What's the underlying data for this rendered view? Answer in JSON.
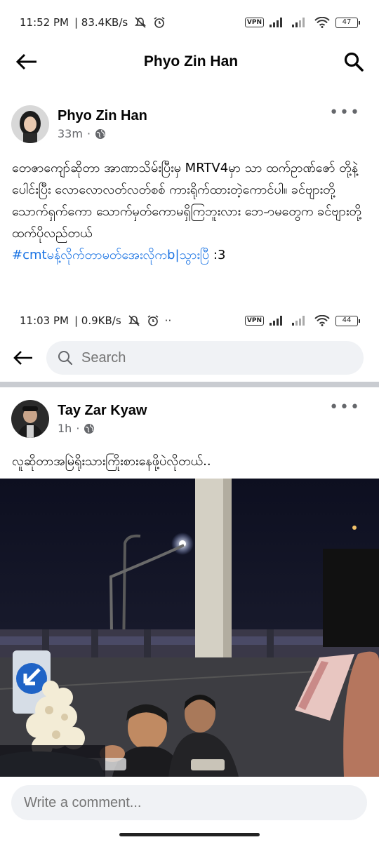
{
  "status_bar": {
    "time": "11:52 PM",
    "speed": "| 83.4KB/s",
    "vpn": "VPN",
    "battery": "47"
  },
  "appbar": {
    "title": "Phyo Zin Han"
  },
  "post1": {
    "author": "Phyo Zin Han",
    "time": "33m",
    "dot": "·",
    "more": "•••",
    "text": "တေဇာကျော်ဆိုတာ အာဏာသိမ်းပြီးမှ MRTV4မှာ သာ ထက်ဥာဏ်ဇော် တို့နဲ့ပေါင်းပြီး  လောလောလတ်လတ်စစ် ကားရိုက်ထားတဲ့ကောင်ပါ။ ခင်ဗျားတို့သောက်ရှက်ကော သောက်မှတ်ကောမရှိကြဘူးလား ဘေ-ာမတွေက ခင်ဗျားတို့ထက်ပိုလည်တယ်",
    "hashtag": "#cmtမန့်လိုက်တာမတ်အေးလိုကb|သွားပြီ",
    "suffix": " :3"
  },
  "inner_status": {
    "time": "11:03 PM",
    "speed": "| 0.9KB/s",
    "extra": "··",
    "vpn": "VPN",
    "battery": "44"
  },
  "search": {
    "placeholder": "Search"
  },
  "post2": {
    "author": "Tay Zar Kyaw",
    "time": "1h",
    "dot": "·",
    "more": "•••",
    "text": "လူဆိုတာအမြဲရိုးသားကြိုးစားနေဖို့ပဲလိုတယ်.."
  },
  "comment": {
    "placeholder": "Write a comment..."
  },
  "colors": {
    "link": "#1b74e4",
    "muted": "#65676b",
    "input_bg": "#f0f2f5"
  }
}
